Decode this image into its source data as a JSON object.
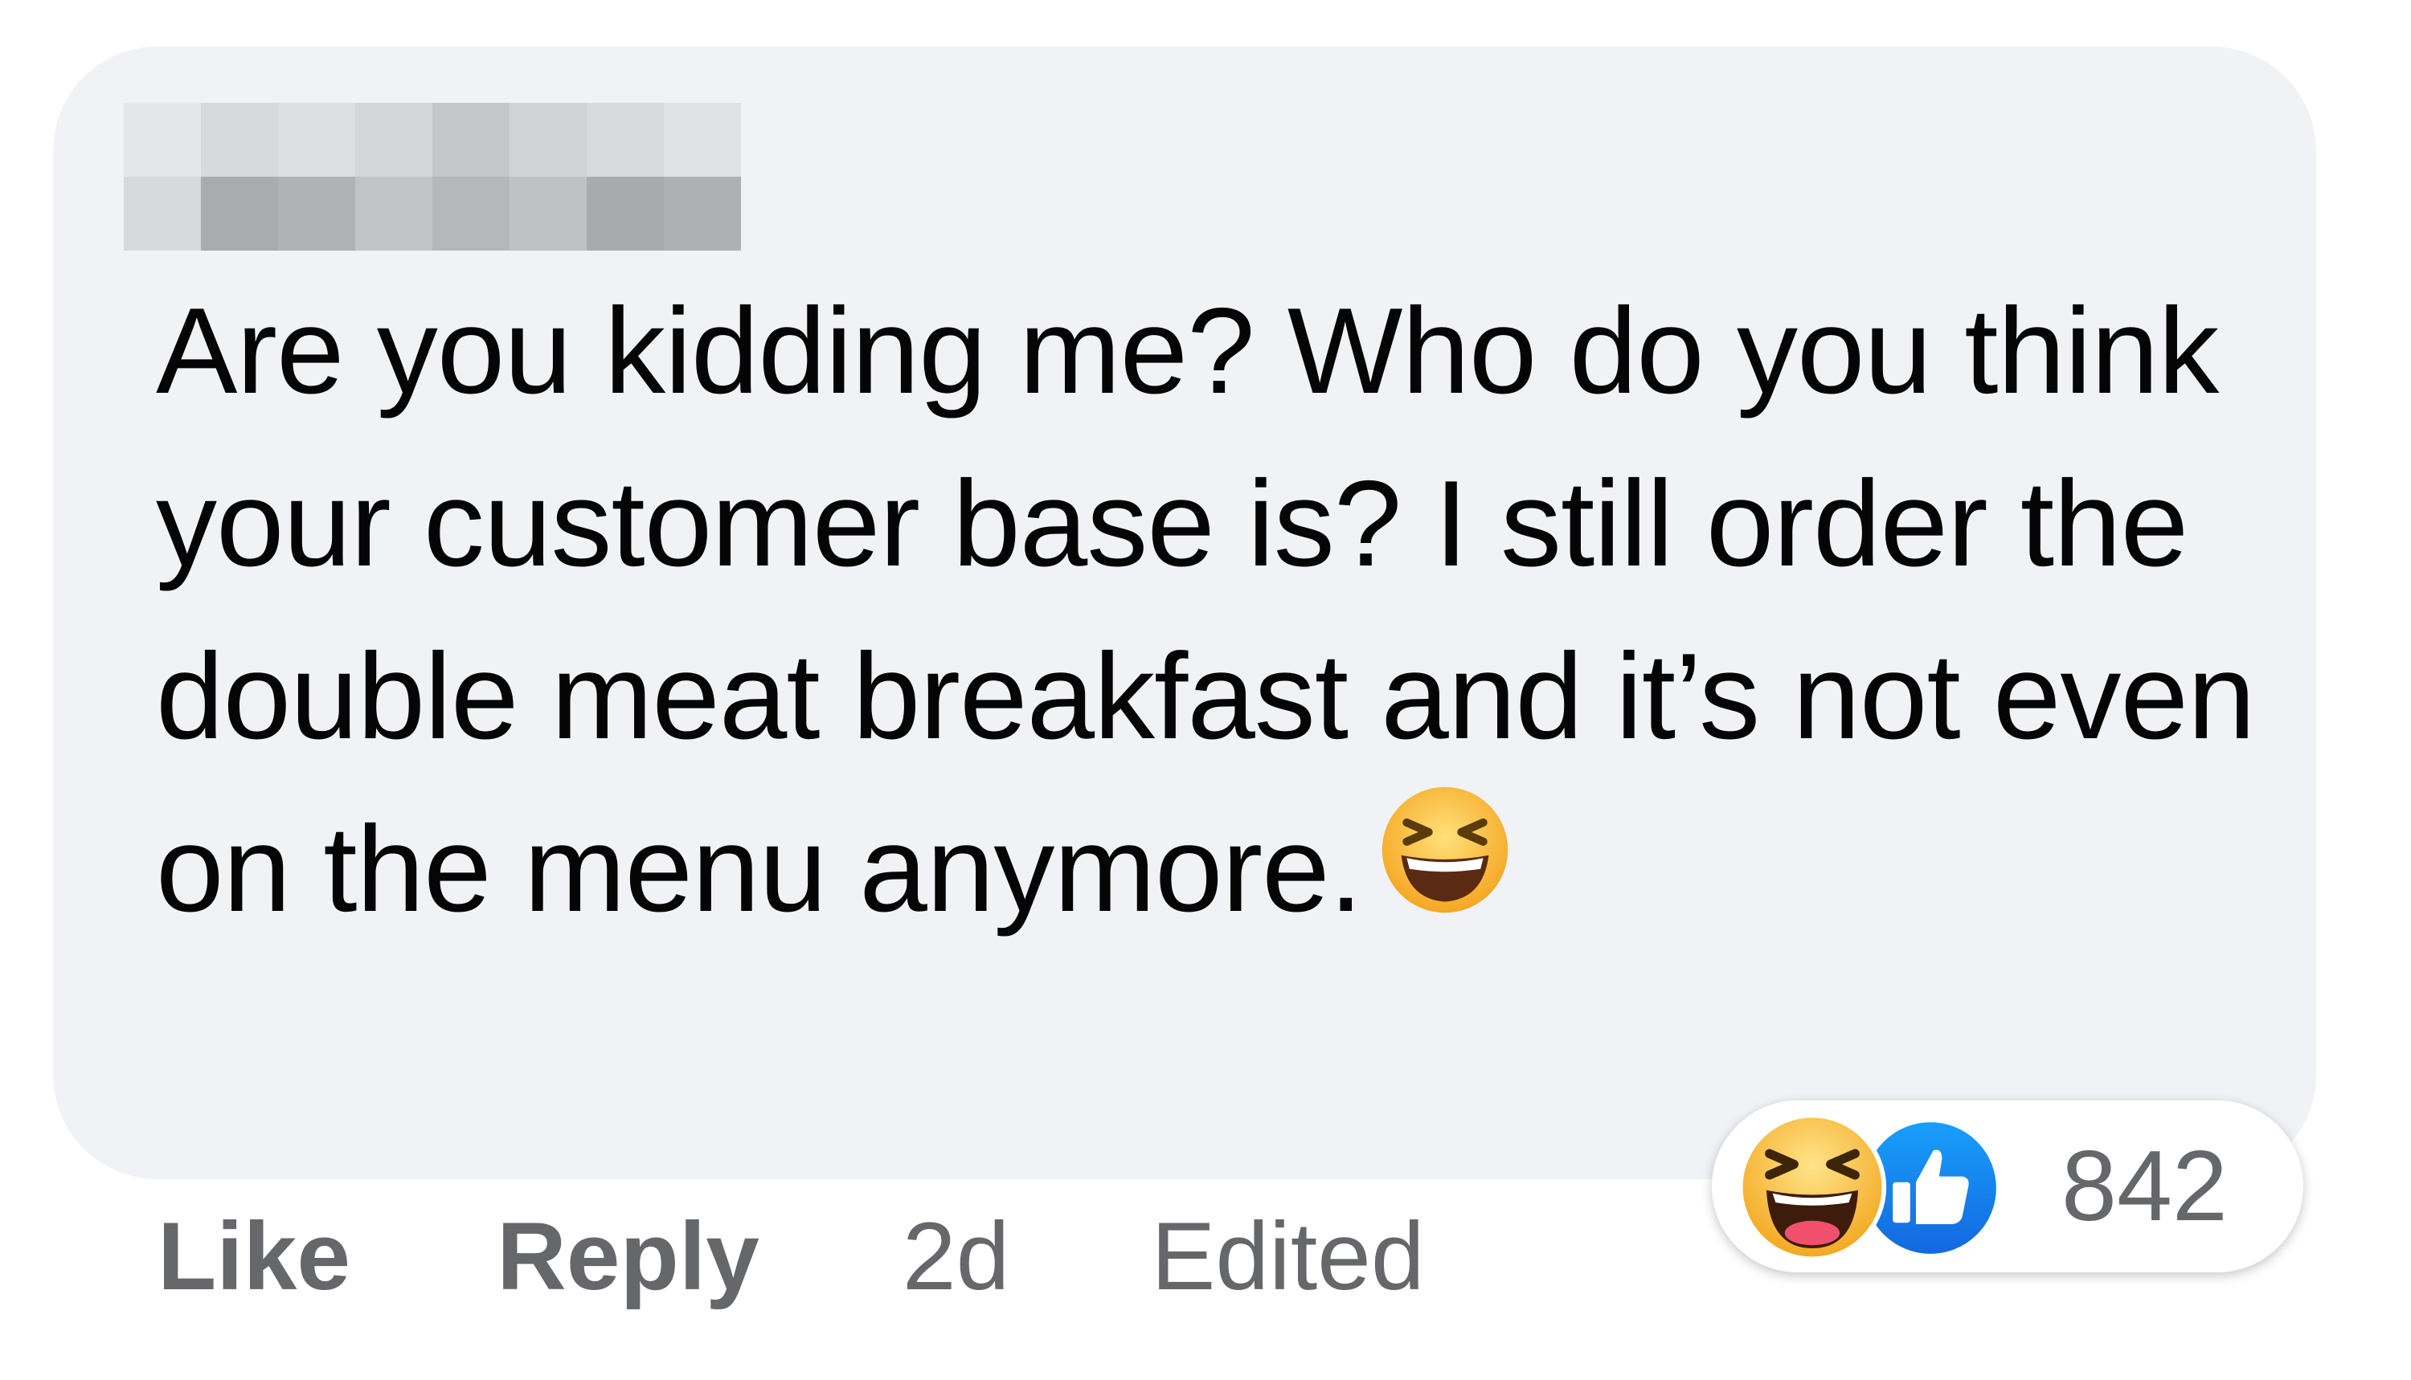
{
  "comment": {
    "author_name_redacted": true,
    "text": "Are you kidding me? Who do you think your customer base is? I still order the double meat breakfast and it’s not even on the menu anymore.",
    "inline_emoji": "laughing-face-icon"
  },
  "actions": {
    "like_label": "Like",
    "reply_label": "Reply",
    "timestamp": "2d",
    "edited_label": "Edited"
  },
  "reactions": {
    "icons": [
      "haha-reaction-icon",
      "like-reaction-icon"
    ],
    "count": "842"
  },
  "colors": {
    "bubble_bg": "#f0f2f5",
    "text": "#050505",
    "secondary_text": "#65676b",
    "like_blue": "#1877f2",
    "haha_yellow": "#f7b928"
  }
}
